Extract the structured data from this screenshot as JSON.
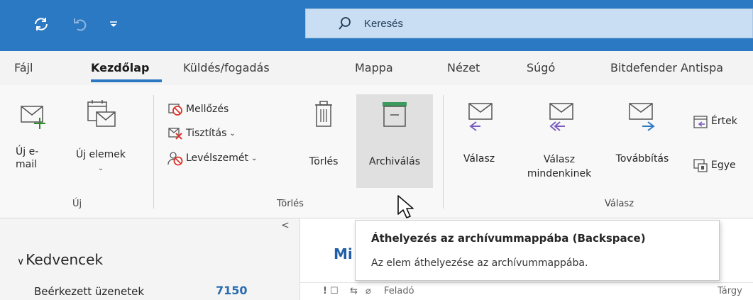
{
  "quick_access": {
    "sync_icon": "sync-icon",
    "undo_icon": "undo-icon",
    "customize_icon": "customize-icon"
  },
  "search": {
    "label": "Keresés",
    "icon": "search-icon"
  },
  "menu": {
    "tabs": [
      "Fájl",
      "Kezdőlap",
      "Küldés/fogadás",
      "Mappa",
      "Nézet",
      "Súgó",
      "Bitdefender Antispa"
    ],
    "active": "Kezdőlap"
  },
  "ribbon": {
    "new_group": {
      "new_email": "Új e-\nmail",
      "new_items": "Új elemek",
      "label": "Új"
    },
    "delete_group": {
      "ignore": "Mellőzés",
      "cleanup": "Tisztítás",
      "junk": "Levélszemét",
      "delete": "Törlés",
      "archive": "Archiválás",
      "label": "Törlés"
    },
    "respond_group": {
      "reply": "Válasz",
      "reply_all": "Válasz\nmindenkinek",
      "forward": "Továbbítás",
      "meeting": "Értek",
      "more": "Egye",
      "label": "Válasz"
    }
  },
  "folder_pane": {
    "favorites": "Kedvencek",
    "inbox_label": "Beérkezett üzenetek",
    "inbox_count": "7150"
  },
  "message_list": {
    "focused_tab": "Mi",
    "from_col": "Feladó",
    "subject_col": "Tárgy"
  },
  "tooltip": {
    "title": "Áthelyezés az archívummappába (Backspace)",
    "description": "Az elem áthelyezése az archívummappába."
  },
  "colors": {
    "accent": "#2b79c2",
    "search_bg": "#c9def2"
  }
}
